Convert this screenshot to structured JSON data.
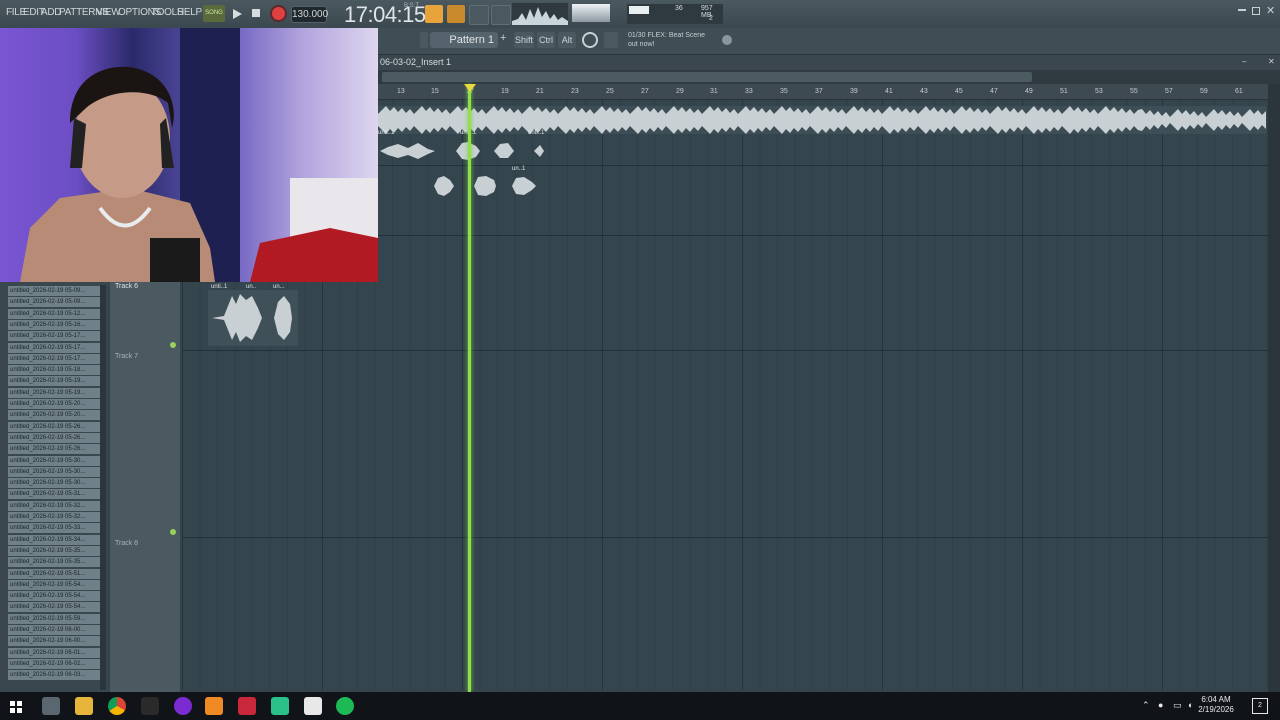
{
  "menu": [
    "FILE",
    "EDIT",
    "ADD",
    "PATTERNS",
    "VIEW",
    "OPTIONS",
    "TOOLS",
    "HELP"
  ],
  "transport": {
    "song_label": "SONG",
    "tempo": "130.000",
    "clock": "17:04:15",
    "clock_sub": "B:S:T"
  },
  "monitor": {
    "cpu": "36",
    "mem": "957 MB",
    "voices": "2"
  },
  "pattern_label": "Pattern 1",
  "mod_keys": [
    "Shift",
    "Ctrl",
    "Alt"
  ],
  "hint": {
    "line1": "01/30  FLEX: Beat Scene",
    "line2": "out now!"
  },
  "playlist_title": "06-03-02_Insert 1",
  "ruler": [
    "13",
    "15",
    "17",
    "19",
    "21",
    "23",
    "25",
    "27",
    "29",
    "31",
    "33",
    "35",
    "37",
    "39",
    "41",
    "43",
    "45",
    "47",
    "49",
    "51",
    "53",
    "55",
    "57",
    "59",
    "61"
  ],
  "tracks": {
    "track6": "Track 6",
    "track7": "Track 7",
    "track8": "Track 8"
  },
  "clips": {
    "a": "unti..1",
    "b": "unti..1",
    "c": "unti..1",
    "d": "un..1",
    "e": "unti..1",
    "f": "un..",
    "g": "un..."
  },
  "browser": [
    "untitled_2026-02-19 05-09...",
    "untitled_2026-02-19 05-09...",
    "untitled_2026-02-19 05-12...",
    "untitled_2026-02-19 05-16...",
    "untitled_2026-02-19 05-17...",
    "untitled_2026-02-19 05-17...",
    "untitled_2026-02-19 05-17...",
    "untitled_2026-02-19 05-18...",
    "untitled_2026-02-19 05-19...",
    "untitled_2026-02-19 05-19...",
    "untitled_2026-02-19 05-20...",
    "untitled_2026-02-19 05-20...",
    "untitled_2026-02-19 05-26...",
    "untitled_2026-02-19 05-26...",
    "untitled_2026-02-19 05-26...",
    "untitled_2026-02-19 05-30...",
    "untitled_2026-02-19 05-30...",
    "untitled_2026-02-19 05-30...",
    "untitled_2026-02-19 05-31...",
    "untitled_2026-02-19 05-32...",
    "untitled_2026-02-19 05-32...",
    "untitled_2026-02-19 05-33...",
    "untitled_2026-02-19 05-34...",
    "untitled_2026-02-19 05-35...",
    "untitled_2026-02-19 05-35...",
    "untitled_2026-02-19 05-51...",
    "untitled_2026-02-19 05-54...",
    "untitled_2026-02-19 05-54...",
    "untitled_2026-02-19 05-54...",
    "untitled_2026-02-19 05-59...",
    "untitled_2026-02-19 06-00...",
    "untitled_2026-02-19 06-00...",
    "untitled_2026-02-19 06-01...",
    "untitled_2026-02-19 06-02...",
    "untitled_2026-02-19 06-03..."
  ],
  "taskbar": {
    "time": "6:04 AM",
    "date": "2/19/2026",
    "notif": "2"
  },
  "colors": {
    "playhead": "#8fe04a",
    "accent": "#e8a33a",
    "record": "#e04040"
  }
}
